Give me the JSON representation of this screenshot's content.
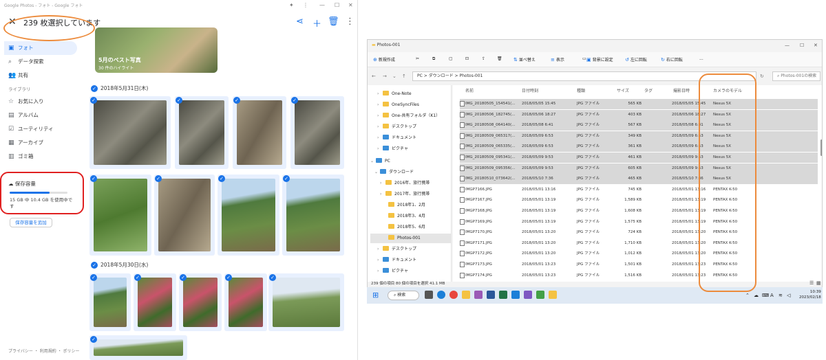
{
  "google_photos": {
    "window_title": "Google Photos - フォト - Google フォト",
    "selection_text": "239 枚選択しています",
    "nav": [
      {
        "icon": "photo-icon",
        "label": "フォト"
      },
      {
        "icon": "search-icon",
        "label": "データ探索"
      },
      {
        "icon": "people-icon",
        "label": "共有"
      }
    ],
    "library_label": "ライブラリ",
    "library": [
      {
        "icon": "star-icon",
        "label": "お気に入り"
      },
      {
        "icon": "album-icon",
        "label": "アルバム"
      },
      {
        "icon": "utility-icon",
        "label": "ユーティリティ"
      },
      {
        "icon": "archive-icon",
        "label": "アーカイブ"
      },
      {
        "icon": "trash-icon",
        "label": "ゴミ箱"
      }
    ],
    "storage": {
      "title": "保存容量",
      "usage": "15 GB 中 10.4 GB を使用中です",
      "used_fraction": 0.69,
      "add_button": "保存容量を追加"
    },
    "footer": "プライバシー ・ 利用規約 ・ ポリシー",
    "highlight": {
      "title": "5月のベスト写真",
      "subtitle": "30 件のハイライト"
    },
    "date_headers": [
      "2018年5月31日(木)",
      "2018年5月30日(水)"
    ]
  },
  "explorer": {
    "window_title": "Photos-001",
    "toolbar": [
      "新規作成",
      "並べ替え",
      "表示",
      "背景に設定",
      "左に回転",
      "右に回転",
      "..."
    ],
    "address": "PC  >  ダウンロード  >  Photos-001",
    "search_placeholder": "Photos-001の検索",
    "tree": [
      {
        "label": "One-Note",
        "type": "folder"
      },
      {
        "label": "OneSyncFiles",
        "type": "folder"
      },
      {
        "label": "One-共有フォルダ（K1）",
        "type": "folder"
      },
      {
        "label": "デスクトップ",
        "type": "folder"
      },
      {
        "label": "ドキュメント",
        "type": "doc"
      },
      {
        "label": "ピクチャ",
        "type": "pic"
      },
      {
        "label": "PC",
        "type": "pc"
      },
      {
        "label": "ダウンロード",
        "type": "dl"
      },
      {
        "label": "2016年、旅行携帯",
        "type": "folder"
      },
      {
        "label": "2017年、旅行携帯",
        "type": "folder"
      },
      {
        "label": "2018年1、2月",
        "type": "folder"
      },
      {
        "label": "2018年3、4月",
        "type": "folder"
      },
      {
        "label": "2018年5、6月",
        "type": "folder"
      },
      {
        "label": "Photos-001",
        "type": "folder"
      },
      {
        "label": "デスクトップ",
        "type": "folder"
      },
      {
        "label": "ドキュメント",
        "type": "doc"
      },
      {
        "label": "ピクチャ",
        "type": "pic"
      }
    ],
    "columns": [
      "名前",
      "日付時刻",
      "種類",
      "サイズ",
      "タグ",
      "撮影日時",
      "カメラのモデル"
    ],
    "rows": [
      {
        "name": "IMG_20180505_154541(...",
        "date": "2018/05/05 15:45",
        "type": "JPG ファイル",
        "size": "565 KB",
        "taken": "2018/05/05 15:45",
        "camera": "Nexus 5X",
        "selected": true
      },
      {
        "name": "IMG_20180506_182745(...",
        "date": "2018/05/06 18:27",
        "type": "JPG ファイル",
        "size": "403 KB",
        "taken": "2018/05/06 18:27",
        "camera": "Nexus 5X",
        "selected": true
      },
      {
        "name": "IMG_20180508_064140(...",
        "date": "2018/05/08 6:41",
        "type": "JPG ファイル",
        "size": "567 KB",
        "taken": "2018/05/08 6:41",
        "camera": "Nexus 5X",
        "selected": true
      },
      {
        "name": "IMG_20180509_065317(...",
        "date": "2018/05/09 6:53",
        "type": "JPG ファイル",
        "size": "349 KB",
        "taken": "2018/05/09 6:53",
        "camera": "Nexus 5X",
        "selected": true
      },
      {
        "name": "IMG_20180509_065335(...",
        "date": "2018/05/09 6:53",
        "type": "JPG ファイル",
        "size": "361 KB",
        "taken": "2018/05/09 6:53",
        "camera": "Nexus 5X",
        "selected": true
      },
      {
        "name": "IMG_20180509_095341(...",
        "date": "2018/05/09 9:53",
        "type": "JPG ファイル",
        "size": "461 KB",
        "taken": "2018/05/09 9:53",
        "camera": "Nexus 5X",
        "selected": true
      },
      {
        "name": "IMG_20180509_095356(...",
        "date": "2018/05/09 9:53",
        "type": "JPG ファイル",
        "size": "605 KB",
        "taken": "2018/05/09 9:53",
        "camera": "Nexus 5X",
        "selected": true
      },
      {
        "name": "IMG_20180510_073642(...",
        "date": "2018/05/10 7:36",
        "type": "JPG ファイル",
        "size": "465 KB",
        "taken": "2018/05/10 7:36",
        "camera": "Nexus 5X",
        "selected": true
      },
      {
        "name": "IMGP7166.JPG",
        "date": "2018/05/01 13:16",
        "type": "JPG ファイル",
        "size": "745 KB",
        "taken": "2018/05/01 13:16",
        "camera": "PENTAX K-50",
        "selected": false
      },
      {
        "name": "IMGP7167.JPG",
        "date": "2018/05/01 13:19",
        "type": "JPG ファイル",
        "size": "1,589 KB",
        "taken": "2018/05/01 13:19",
        "camera": "PENTAX K-50",
        "selected": false
      },
      {
        "name": "IMGP7168.JPG",
        "date": "2018/05/01 13:19",
        "type": "JPG ファイル",
        "size": "1,608 KB",
        "taken": "2018/05/01 13:19",
        "camera": "PENTAX K-50",
        "selected": false
      },
      {
        "name": "IMGP7169.JPG",
        "date": "2018/05/01 13:19",
        "type": "JPG ファイル",
        "size": "1,575 KB",
        "taken": "2018/05/01 13:19",
        "camera": "PENTAX K-50",
        "selected": false
      },
      {
        "name": "IMGP7170.JPG",
        "date": "2018/05/01 13:20",
        "type": "JPG ファイル",
        "size": "724 KB",
        "taken": "2018/05/01 13:20",
        "camera": "PENTAX K-50",
        "selected": false
      },
      {
        "name": "IMGP7171.JPG",
        "date": "2018/05/01 13:20",
        "type": "JPG ファイル",
        "size": "1,710 KB",
        "taken": "2018/05/01 13:20",
        "camera": "PENTAX K-50",
        "selected": false
      },
      {
        "name": "IMGP7172.JPG",
        "date": "2018/05/01 13:20",
        "type": "JPG ファイル",
        "size": "1,012 KB",
        "taken": "2018/05/01 13:20",
        "camera": "PENTAX K-50",
        "selected": false
      },
      {
        "name": "IMGP7173.JPG",
        "date": "2018/05/01 13:23",
        "type": "JPG ファイル",
        "size": "1,501 KB",
        "taken": "2018/05/01 13:23",
        "camera": "PENTAX K-50",
        "selected": false
      },
      {
        "name": "IMGP7174.JPG",
        "date": "2018/05/01 13:23",
        "type": "JPG ファイル",
        "size": "1,516 KB",
        "taken": "2018/05/01 13:23",
        "camera": "PENTAX K-50",
        "selected": false
      }
    ],
    "status": "239 個の項目     80 個の項目を選択  41.1 MB"
  },
  "taskbar": {
    "search": "検索",
    "time": "10:39",
    "date": "2023/02/18",
    "tray_lang": "A"
  }
}
